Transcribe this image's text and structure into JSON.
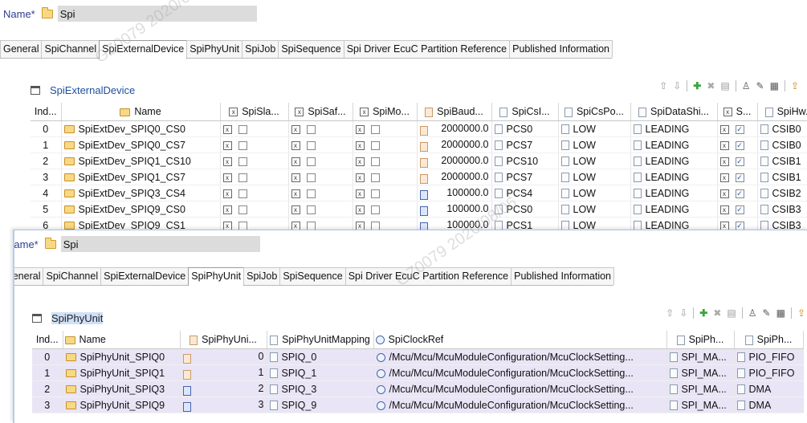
{
  "panel1": {
    "name_label": "Name*",
    "name_value": "Spi",
    "tabs": [
      "General",
      "SpiChannel",
      "SpiExternalDevice",
      "SpiPhyUnit",
      "SpiJob",
      "SpiSequence",
      "Spi Driver EcuC Partition Reference",
      "Published Information"
    ],
    "active_tab": "SpiExternalDevice",
    "section_title": "SpiExternalDevice",
    "columns": [
      "Ind...",
      "Name",
      "SpiSla...",
      "SpiSaf...",
      "SpiMo...",
      "SpiBaud...",
      "SpiCsI...",
      "SpiCsPo...",
      "SpiDataShi...",
      "S...",
      "SpiHw..."
    ],
    "rows": [
      {
        "idx": "0",
        "name": "SpiExtDev_SPIQ0_CS0",
        "baud": "2000000.0",
        "csid": "PCS0",
        "cspol": "LOW",
        "shift": "LEADING",
        "hw": "CSIB0"
      },
      {
        "idx": "1",
        "name": "SpiExtDev_SPIQ0_CS7",
        "baud": "2000000.0",
        "csid": "PCS7",
        "cspol": "LOW",
        "shift": "LEADING",
        "hw": "CSIB0"
      },
      {
        "idx": "2",
        "name": "SpiExtDev_SPIQ1_CS10",
        "baud": "2000000.0",
        "csid": "PCS10",
        "cspol": "LOW",
        "shift": "LEADING",
        "hw": "CSIB1"
      },
      {
        "idx": "3",
        "name": "SpiExtDev_SPIQ1_CS7",
        "baud": "2000000.0",
        "csid": "PCS7",
        "cspol": "LOW",
        "shift": "LEADING",
        "hw": "CSIB1"
      },
      {
        "idx": "4",
        "name": "SpiExtDev_SPIQ3_CS4",
        "baud": "100000.0",
        "csid": "PCS4",
        "cspol": "LOW",
        "shift": "LEADING",
        "hw": "CSIB2"
      },
      {
        "idx": "5",
        "name": "SpiExtDev_SPIQ9_CS0",
        "baud": "100000.0",
        "csid": "PCS0",
        "cspol": "LOW",
        "shift": "LEADING",
        "hw": "CSIB3"
      },
      {
        "idx": "6",
        "name": "SpiExtDev_SPIQ9_CS1",
        "baud": "100000.0",
        "csid": "PCS1",
        "cspol": "LOW",
        "shift": "LEADING",
        "hw": "CSIB3"
      }
    ]
  },
  "panel2": {
    "name_label": "Name*",
    "name_value": "Spi",
    "tabs": [
      "General",
      "SpiChannel",
      "SpiExternalDevice",
      "SpiPhyUnit",
      "SpiJob",
      "SpiSequence",
      "Spi Driver EcuC Partition Reference",
      "Published Information"
    ],
    "active_tab": "SpiPhyUnit",
    "section_title": "SpiPhyUnit",
    "columns": [
      "Ind...",
      "Name",
      "SpiPhyUni...",
      "SpiPhyUnitMapping",
      "SpiClockRef",
      "SpiPh...",
      "SpiPh..."
    ],
    "rows": [
      {
        "idx": "0",
        "name": "SpiPhyUnit_SPIQ0",
        "unit": "0",
        "mapping": "SPIQ_0",
        "clock": "/Mcu/Mcu/McuModuleConfiguration/McuClockSetting...",
        "ph1": "SPI_MA...",
        "ph2": "PIO_FIFO"
      },
      {
        "idx": "1",
        "name": "SpiPhyUnit_SPIQ1",
        "unit": "1",
        "mapping": "SPIQ_1",
        "clock": "/Mcu/Mcu/McuModuleConfiguration/McuClockSetting...",
        "ph1": "SPI_MA...",
        "ph2": "PIO_FIFO"
      },
      {
        "idx": "2",
        "name": "SpiPhyUnit_SPIQ3",
        "unit": "2",
        "mapping": "SPIQ_3",
        "clock": "/Mcu/Mcu/McuModuleConfiguration/McuClockSetting...",
        "ph1": "SPI_MA...",
        "ph2": "DMA"
      },
      {
        "idx": "3",
        "name": "SpiPhyUnit_SPIQ9",
        "unit": "3",
        "mapping": "SPIQ_9",
        "clock": "/Mcu/Mcu/McuModuleConfiguration/McuClockSetting...",
        "ph1": "SPI_MA...",
        "ph2": "DMA"
      }
    ]
  },
  "watermark": "GZ0079 2020/08/06",
  "colors": {
    "title_blue": "#1f4fa0",
    "selected_row": "#e9e5f6",
    "add_green": "#3aa43a"
  }
}
